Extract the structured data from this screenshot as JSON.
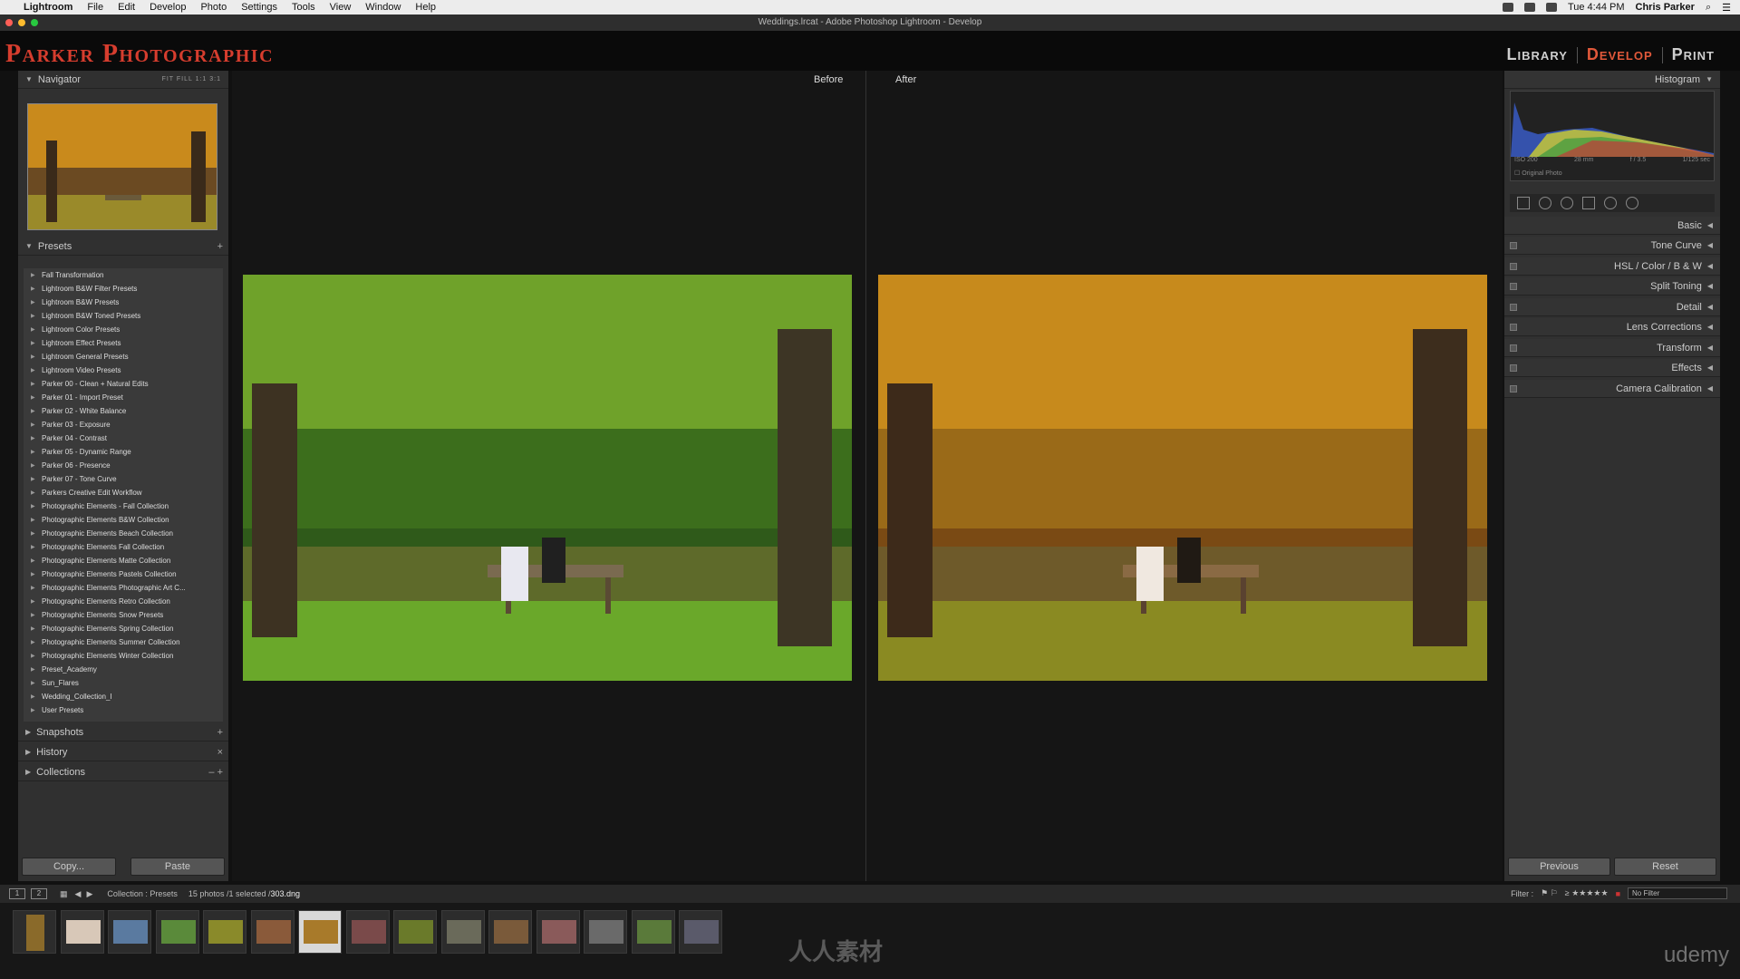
{
  "menubar": {
    "app": "Lightroom",
    "items": [
      "File",
      "Edit",
      "Develop",
      "Photo",
      "Settings",
      "Tools",
      "View",
      "Window",
      "Help"
    ],
    "time": "Tue 4:44 PM",
    "user": "Chris Parker"
  },
  "window": {
    "title": "Weddings.lrcat - Adobe Photoshop Lightroom - Develop"
  },
  "identity": {
    "brand": "Parker Photographic"
  },
  "modules": {
    "library": "Library",
    "develop": "Develop",
    "print": "Print"
  },
  "navigator": {
    "title": "Navigator",
    "options": "FIT  FILL  1:1  3:1"
  },
  "presets": {
    "title": "Presets",
    "items": [
      "Fall Transformation",
      "Lightroom B&W Filter Presets",
      "Lightroom B&W Presets",
      "Lightroom B&W Toned Presets",
      "Lightroom Color Presets",
      "Lightroom Effect Presets",
      "Lightroom General Presets",
      "Lightroom Video Presets",
      "Parker 00 - Clean + Natural Edits",
      "Parker 01 - Import Preset",
      "Parker 02 - White Balance",
      "Parker 03 - Exposure",
      "Parker 04 - Contrast",
      "Parker 05 - Dynamic Range",
      "Parker 06 - Presence",
      "Parker 07 - Tone Curve",
      "Parkers Creative Edit Workflow",
      "Photographic Elements - Fall Collection",
      "Photographic Elements B&W Collection",
      "Photographic Elements Beach Collection",
      "Photographic Elements Fall Collection",
      "Photographic Elements Matte Collection",
      "Photographic Elements Pastels Collection",
      "Photographic Elements Photographic Art C...",
      "Photographic Elements Retro Collection",
      "Photographic Elements Snow Presets",
      "Photographic Elements Spring Collection",
      "Photographic Elements Summer Collection",
      "Photographic Elements Winter Collection",
      "Preset_Academy",
      "Sun_Flares",
      "Wedding_Collection_I",
      "User Presets"
    ]
  },
  "left_sections": {
    "snapshots": "Snapshots",
    "history": "History",
    "collections": "Collections"
  },
  "left_buttons": {
    "copy": "Copy...",
    "paste": "Paste"
  },
  "view": {
    "before": "Before",
    "after": "After"
  },
  "right": {
    "histogram": "Histogram",
    "iso": "ISO 200",
    "focal": "28 mm",
    "aperture": "f / 3.5",
    "shutter": "1/125 sec",
    "original": "Original Photo",
    "panels": [
      "Basic",
      "Tone Curve",
      "HSL  /  Color  /  B & W",
      "Split Toning",
      "Detail",
      "Lens Corrections",
      "Transform",
      "Effects",
      "Camera Calibration"
    ]
  },
  "right_buttons": {
    "previous": "Previous",
    "reset": "Reset"
  },
  "filmstrip_bar": {
    "crumbs": "Collection : Presets",
    "count": "15 photos /1 selected /",
    "file": "303.dng",
    "filter_label": "Filter :",
    "filter_value": "No Filter"
  },
  "overlay": {
    "watermark": "人人素材",
    "udemy": "udemy"
  }
}
